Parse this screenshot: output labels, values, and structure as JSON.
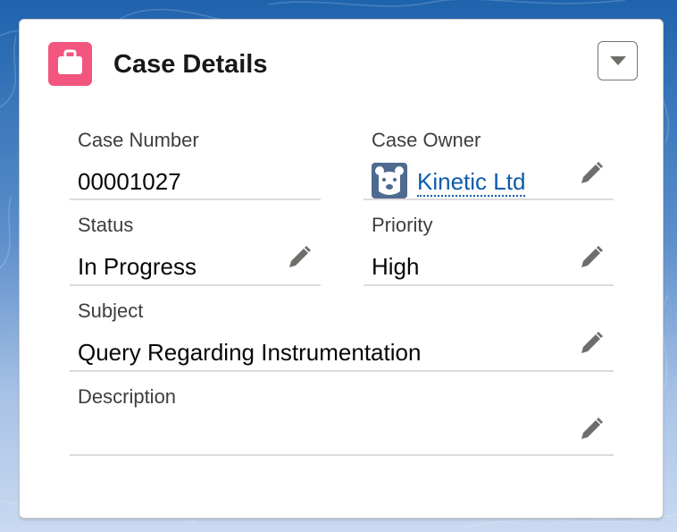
{
  "card": {
    "title": "Case Details",
    "icon": "briefcase-icon",
    "icon_color": "#f2557e",
    "menu_icon": "chevron-down-icon"
  },
  "fields": {
    "case_number": {
      "label": "Case Number",
      "value": "00001027"
    },
    "case_owner": {
      "label": "Case Owner",
      "value": "Kinetic Ltd",
      "avatar_icon": "bear-avatar-icon"
    },
    "status": {
      "label": "Status",
      "value": "In Progress"
    },
    "priority": {
      "label": "Priority",
      "value": "High"
    },
    "subject": {
      "label": "Subject",
      "value": "Query Regarding Instrumentation"
    },
    "description": {
      "label": "Description",
      "value": ""
    }
  },
  "colors": {
    "link": "#0b5cab",
    "background": "#1f63ad"
  }
}
